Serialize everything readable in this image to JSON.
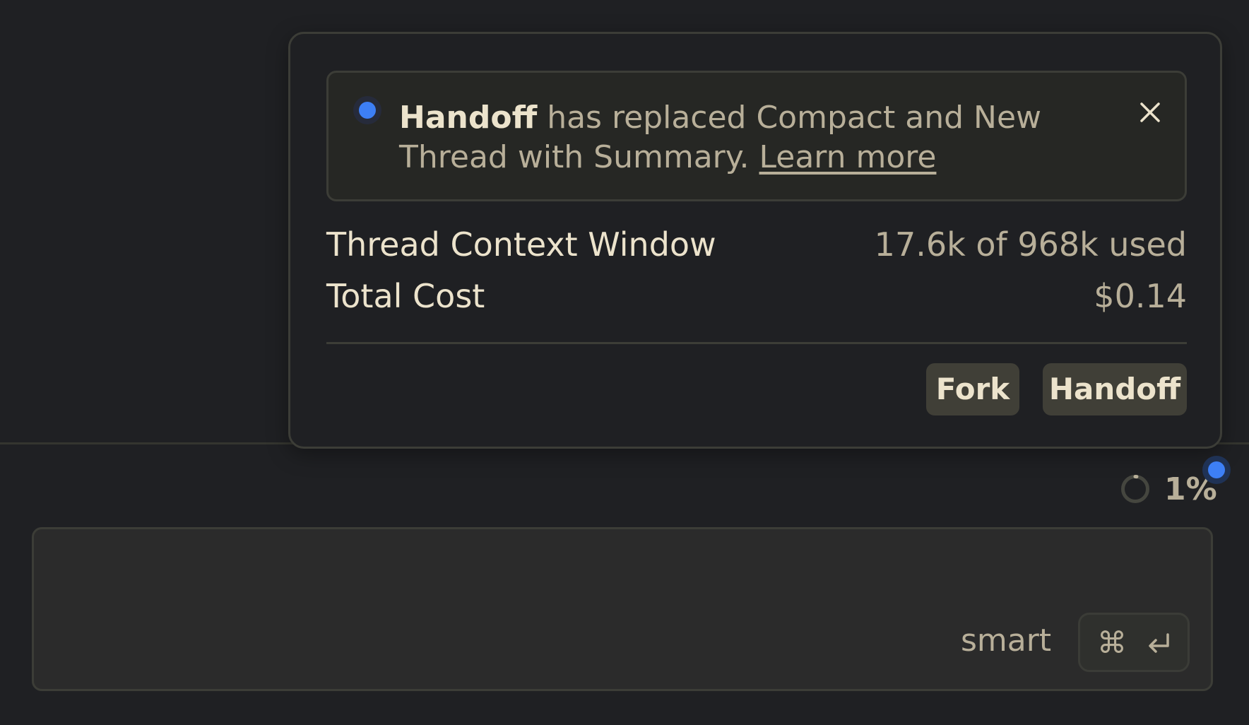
{
  "notice": {
    "highlight": "Handoff",
    "message": " has replaced Compact and New Thread with Summary. ",
    "link_label": "Learn more"
  },
  "stats": {
    "context_label": "Thread Context Window",
    "context_value": "17.6k of 968k used",
    "cost_label": "Total Cost",
    "cost_value": "$0.14"
  },
  "actions": {
    "fork_label": "Fork",
    "handoff_label": "Handoff"
  },
  "context_indicator": {
    "percent_label": "1%",
    "fraction_used": 0.018
  },
  "composer": {
    "value": "",
    "mode_label": "smart",
    "send_shortcut_glyph": "⌘"
  },
  "colors": {
    "background": "#1f2023",
    "accent_blue": "#3d7ff5",
    "text_primary": "#ece3cc",
    "text_secondary": "#b8af99",
    "button_bg": "#403f37"
  },
  "icons": {
    "close": "close-icon",
    "status_dot": "status-dot-icon",
    "progress_ring": "progress-ring-icon",
    "command_key": "command-key-icon",
    "return_key": "return-key-icon"
  }
}
